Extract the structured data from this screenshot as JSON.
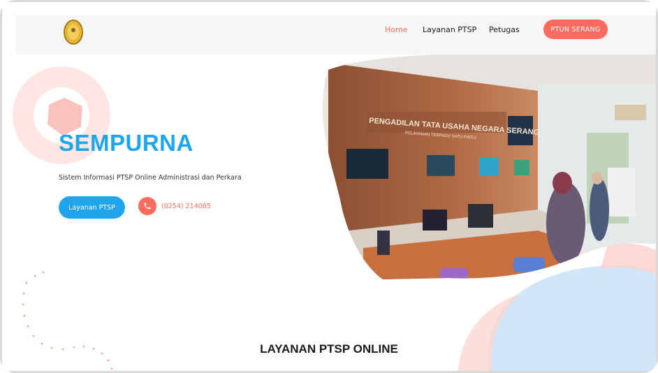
{
  "header": {
    "nav": [
      {
        "label": "Home",
        "active": true
      },
      {
        "label": "Layanan PTSP",
        "active": false
      },
      {
        "label": "Petugas",
        "active": false
      }
    ],
    "cta_label": "PTUN SERANG"
  },
  "hero": {
    "title": "SEMPURNA",
    "subtitle": "Sistem Informasi PTSP Online Administrasi dan Perkara",
    "primary_button": "Layanan PTSP",
    "phone": "(0254) 214085",
    "image_sign_line1": "PENGADILAN TATA USAHA NEGARA SERANG",
    "image_sign_line2": "PELAYANAN TERPADU SATU PINTU"
  },
  "section": {
    "title": "LAYANAN PTSP ONLINE"
  },
  "colors": {
    "accent_coral": "#fc6b5d",
    "accent_blue": "#1ea5ec",
    "header_bg": "#f6f6f6"
  }
}
